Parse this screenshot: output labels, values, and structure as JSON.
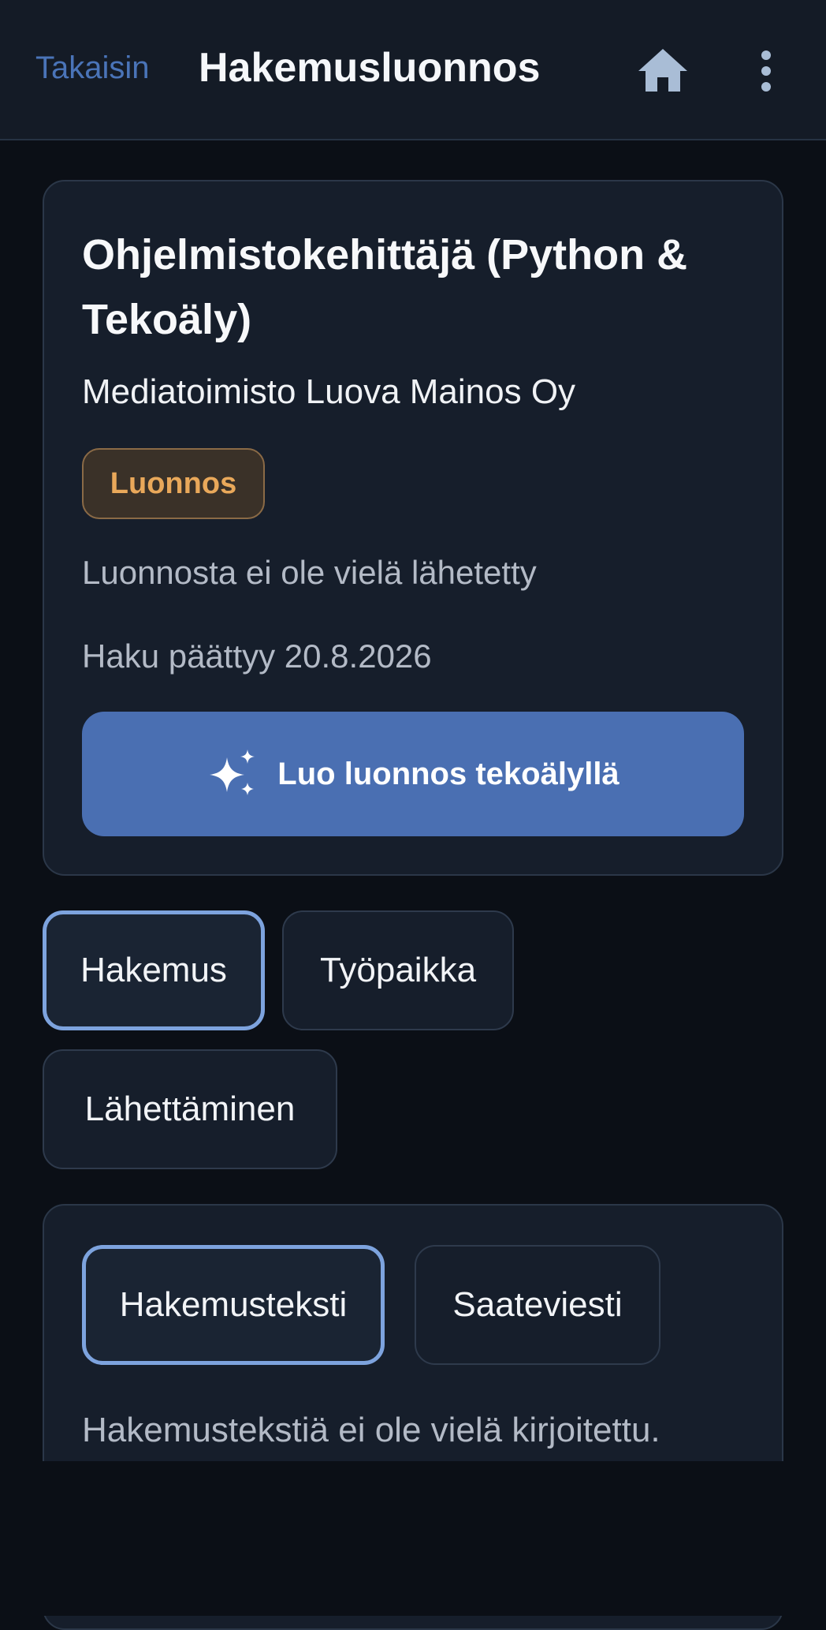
{
  "header": {
    "back_label": "Takaisin",
    "title": "Hakemusluonnos",
    "home_icon": "home-icon",
    "more_icon": "more-vertical-icon"
  },
  "job": {
    "title": "Ohjelmistokehittäjä (Python & Tekoäly)",
    "company": "Mediatoimisto Luova Mainos Oy",
    "status_badge": "Luonnos",
    "status_text": "Luonnosta ei ole vielä lähetetty",
    "deadline": "Haku päättyy 20.8.2026",
    "ai_button_label": "Luo luonnos tekoälyllä",
    "ai_button_icon": "sparkles-icon"
  },
  "tabs": [
    {
      "label": "Hakemus",
      "active": true
    },
    {
      "label": "Työpaikka",
      "active": false
    },
    {
      "label": "Lähettäminen",
      "active": false
    }
  ],
  "application": {
    "subtabs": [
      {
        "label": "Hakemusteksti",
        "active": true
      },
      {
        "label": "Saateviesti",
        "active": false
      }
    ],
    "empty_text": "Hakemustekstiä ei ole vielä kirjoitettu."
  },
  "colors": {
    "background": "#0b0f16",
    "card": "#161e2b",
    "accent": "#4a6fb2",
    "link": "#4a74b8",
    "badge_text": "#e9a85a",
    "active_border": "#7da3de"
  }
}
